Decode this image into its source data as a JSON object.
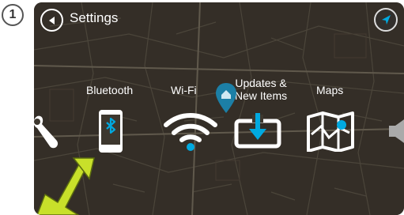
{
  "step": {
    "number": "1"
  },
  "header": {
    "title": "Settings",
    "back_icon": "back-arrow-icon",
    "compass_icon": "compass-arrow-icon"
  },
  "menu": {
    "items": [
      {
        "label": "Wrench",
        "icon": "wrench-icon",
        "shown_label": ""
      },
      {
        "label": "Bluetooth",
        "icon": "bluetooth-phone-icon"
      },
      {
        "label": "Wi-Fi",
        "icon": "wifi-icon"
      },
      {
        "label_line1": "Updates &",
        "label_line2": "New Items",
        "icon": "download-update-icon"
      },
      {
        "label": "Maps",
        "icon": "map-icon"
      },
      {
        "icon": "speaker-icon"
      }
    ]
  },
  "colors": {
    "accent": "#00a9e0",
    "highlight_arrow": "#c8e02a",
    "map_background": "#3a342c",
    "road": "#6b6457"
  }
}
